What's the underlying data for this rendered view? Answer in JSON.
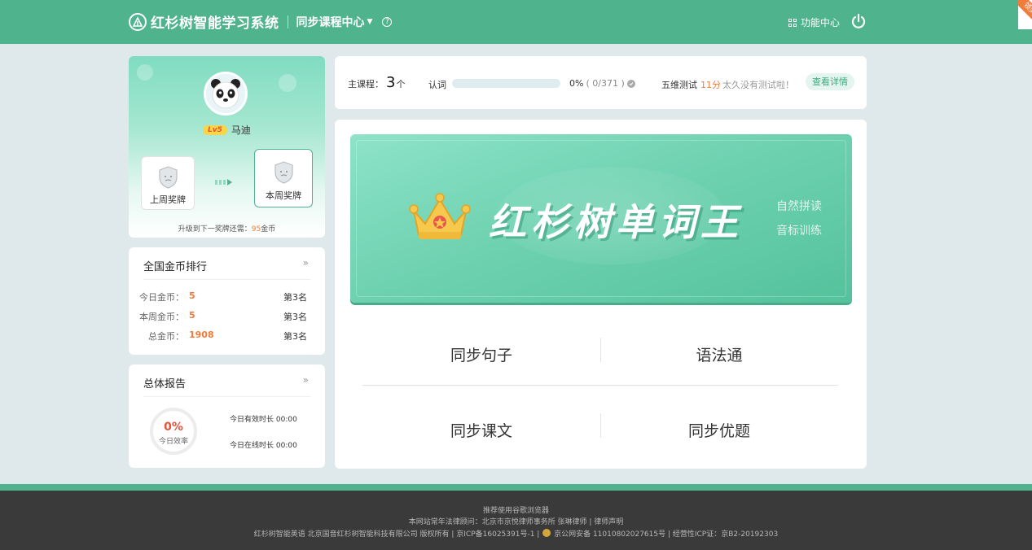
{
  "header": {
    "app_title": "红杉树智能学习系统",
    "course_center": "同步课程中心",
    "func_center": "功能中心",
    "corner_badge": "领奖"
  },
  "profile": {
    "level": "Lv5",
    "name": "马迪",
    "last_week_medal": "上周奖牌",
    "this_week_medal": "本周奖牌",
    "upgrade_prefix": "升级到下一奖牌还需：",
    "upgrade_amount": "95",
    "upgrade_unit": "金币"
  },
  "ranking": {
    "title": "全国金币排行",
    "more": "»",
    "rows": [
      {
        "label": "今日金币：",
        "value": "5",
        "rank": "第3名"
      },
      {
        "label": "本周金币：",
        "value": "5",
        "rank": "第3名"
      },
      {
        "label": "总金币：",
        "value": "1908",
        "rank": "第3名"
      }
    ]
  },
  "report": {
    "title": "总体报告",
    "more": "»",
    "efficiency_pct": "0%",
    "efficiency_label": "今日效率",
    "valid_time": "今日有效时长 00:00",
    "online_time": "今日在线时长 00:00"
  },
  "stats": {
    "main_course_label": "主课程：",
    "main_course_count": "3",
    "main_course_unit": "个",
    "word_label": "认词",
    "word_progress": 0,
    "word_pct": "0%",
    "word_count": "( 0/371 )",
    "test_label": "五维测试",
    "test_time": "11分",
    "test_tip": "太久没有测试啦！",
    "detail_button": "查看详情"
  },
  "banner": {
    "title": "红杉树单词王",
    "sub1": "自然拼读",
    "sub2": "音标训练"
  },
  "modules": [
    "同步句子",
    "语法通",
    "同步课文",
    "同步优题"
  ],
  "footer": {
    "line1": "推荐使用谷歌浏览器",
    "line2": "本网站常年法律顾问：北京市京悦律师事务所 张琳律师 | 律师声明",
    "line3a": "红杉树智能英语 北京国音红杉树智能科技有限公司 版权所有 | 京ICP备16025391号-1 |",
    "line3b": "京公网安备 11010802027615号 | 经营性ICP证：京B2-20192303"
  },
  "colors": {
    "brand_green": "#4fb38e",
    "accent_orange": "#f07b3a",
    "page_bg": "#dfe8ea"
  }
}
